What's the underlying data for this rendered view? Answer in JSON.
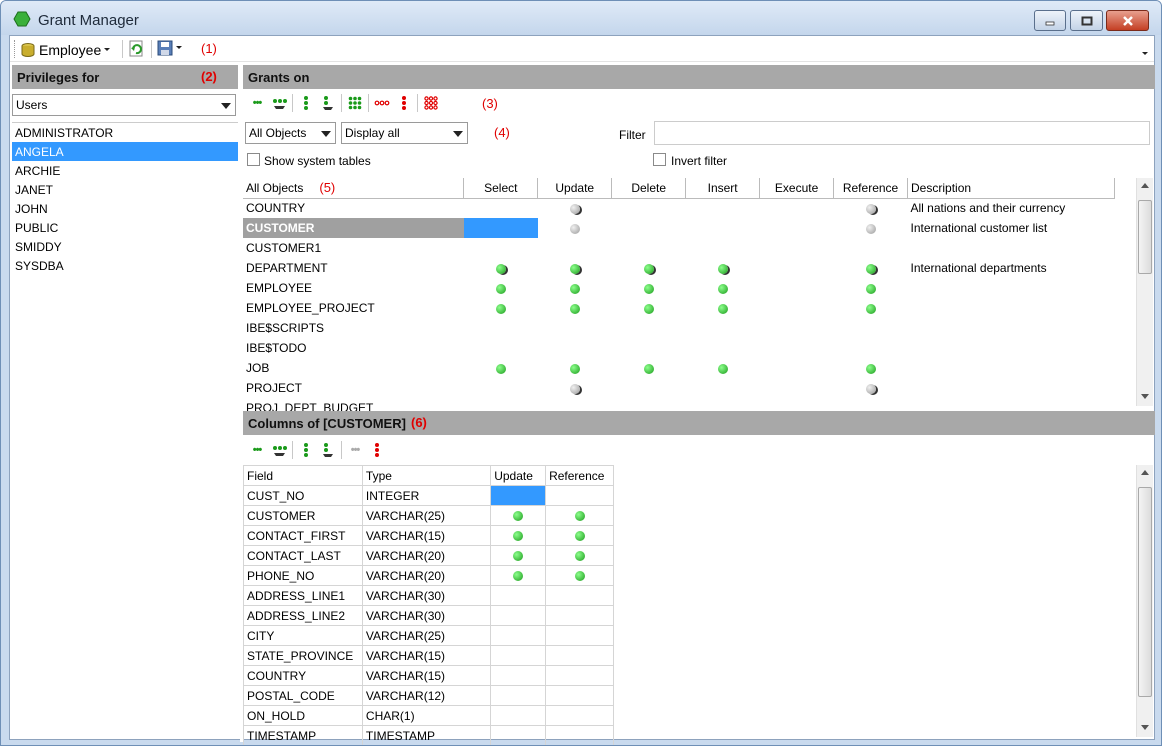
{
  "window": {
    "title": "Grant Manager"
  },
  "toolbar": {
    "database_label": "Employee",
    "marker": "(1)"
  },
  "privileges": {
    "header": "Privileges for",
    "marker": "(2)",
    "type_value": "Users",
    "users": [
      "ADMINISTRATOR",
      "ANGELA",
      "ARCHIE",
      "JANET",
      "JOHN",
      "PUBLIC",
      "SMIDDY",
      "SYSDBA"
    ],
    "selected_user": "ANGELA"
  },
  "grants": {
    "header": "Grants on",
    "toolbar_marker": "(3)",
    "object_filter_value": "All Objects",
    "display_value": "Display all",
    "filter_marker": "(4)",
    "filter_label": "Filter",
    "show_system_tables_label": "Show system tables",
    "invert_filter_label": "Invert filter",
    "table_marker": "(5)",
    "columns": [
      "All Objects",
      "Select",
      "Update",
      "Delete",
      "Insert",
      "Execute",
      "Reference",
      "Description"
    ],
    "rows": [
      {
        "name": "COUNTRY",
        "cells": [
          "",
          "gray-grant",
          "",
          "",
          "",
          "gray-grant"
        ],
        "description": "All nations and their currency"
      },
      {
        "name": "CUSTOMER",
        "cells": [
          "selected",
          "gray",
          "",
          "",
          "",
          "gray"
        ],
        "description": "International customer list"
      },
      {
        "name": "CUSTOMER1",
        "cells": [
          "",
          "",
          "",
          "",
          "",
          ""
        ],
        "description": ""
      },
      {
        "name": "DEPARTMENT",
        "cells": [
          "green-grant",
          "green-grant",
          "green-grant",
          "green-grant",
          "",
          "green-grant"
        ],
        "description": "International departments"
      },
      {
        "name": "EMPLOYEE",
        "cells": [
          "green",
          "green",
          "green",
          "green",
          "",
          "green"
        ],
        "description": ""
      },
      {
        "name": "EMPLOYEE_PROJECT",
        "cells": [
          "green",
          "green",
          "green",
          "green",
          "",
          "green"
        ],
        "description": ""
      },
      {
        "name": "IBE$SCRIPTS",
        "cells": [
          "",
          "",
          "",
          "",
          "",
          ""
        ],
        "description": ""
      },
      {
        "name": "IBE$TODO",
        "cells": [
          "",
          "",
          "",
          "",
          "",
          ""
        ],
        "description": ""
      },
      {
        "name": "JOB",
        "cells": [
          "green",
          "green",
          "green",
          "green",
          "",
          "green"
        ],
        "description": ""
      },
      {
        "name": "PROJECT",
        "cells": [
          "",
          "gray-grant",
          "",
          "",
          "",
          "gray-grant"
        ],
        "description": ""
      },
      {
        "name": "PROJ_DEPT_BUDGET",
        "cells": [
          "",
          "",
          "",
          "",
          "",
          ""
        ],
        "description": ""
      }
    ]
  },
  "columns": {
    "header": "Columns of [CUSTOMER]",
    "marker": "(6)",
    "headers": [
      "Field",
      "Type",
      "Update",
      "Reference"
    ],
    "rows": [
      {
        "field": "CUST_NO",
        "type": "INTEGER",
        "update": "selected",
        "reference": ""
      },
      {
        "field": "CUSTOMER",
        "type": "VARCHAR(25)",
        "update": "green",
        "reference": "green"
      },
      {
        "field": "CONTACT_FIRST",
        "type": "VARCHAR(15)",
        "update": "green",
        "reference": "green"
      },
      {
        "field": "CONTACT_LAST",
        "type": "VARCHAR(20)",
        "update": "green",
        "reference": "green"
      },
      {
        "field": "PHONE_NO",
        "type": "VARCHAR(20)",
        "update": "green",
        "reference": "green"
      },
      {
        "field": "ADDRESS_LINE1",
        "type": "VARCHAR(30)",
        "update": "",
        "reference": ""
      },
      {
        "field": "ADDRESS_LINE2",
        "type": "VARCHAR(30)",
        "update": "",
        "reference": ""
      },
      {
        "field": "CITY",
        "type": "VARCHAR(25)",
        "update": "",
        "reference": ""
      },
      {
        "field": "STATE_PROVINCE",
        "type": "VARCHAR(15)",
        "update": "",
        "reference": ""
      },
      {
        "field": "COUNTRY",
        "type": "VARCHAR(15)",
        "update": "",
        "reference": ""
      },
      {
        "field": "POSTAL_CODE",
        "type": "VARCHAR(12)",
        "update": "",
        "reference": ""
      },
      {
        "field": "ON_HOLD",
        "type": "CHAR(1)",
        "update": "",
        "reference": ""
      },
      {
        "field": "TIMESTAMP",
        "type": "TIMESTAMP",
        "update": "",
        "reference": ""
      }
    ]
  },
  "colors": {
    "selection": "#3399ff",
    "header_gray": "#a8a8a8",
    "marker_red": "#e00000",
    "grant_green": "#1a9a1a"
  }
}
